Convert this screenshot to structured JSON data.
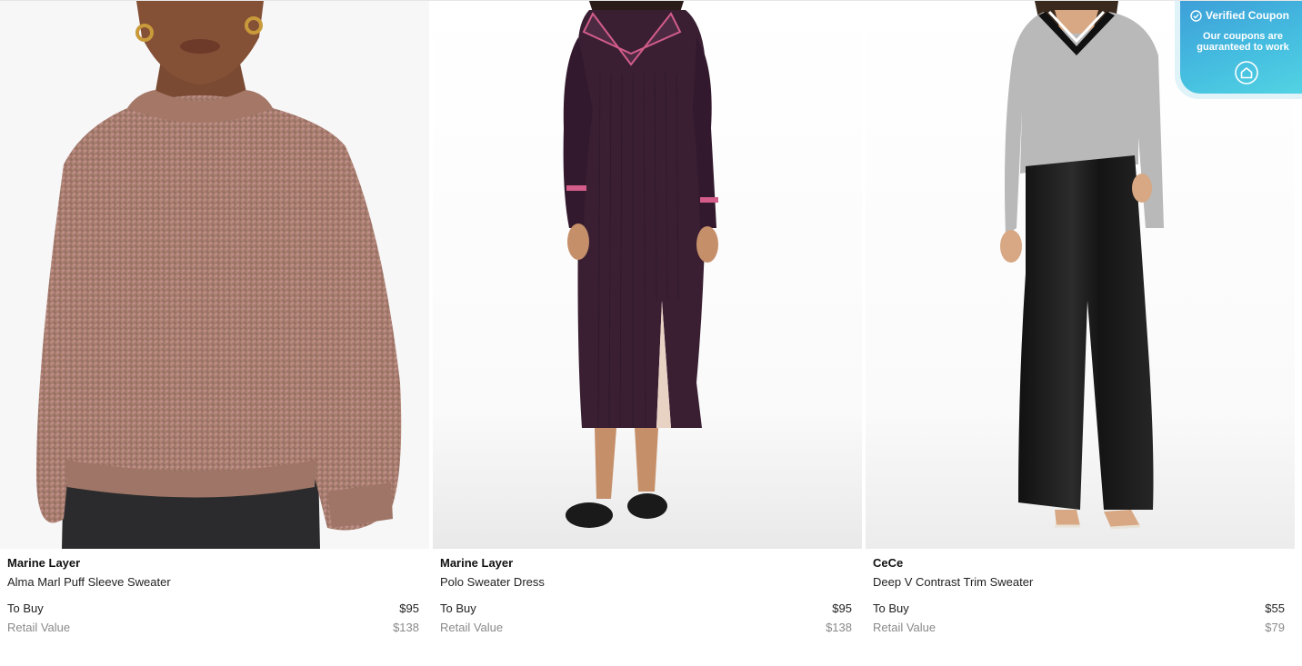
{
  "products": [
    {
      "brand": "Marine Layer",
      "name": "Alma Marl Puff Sleeve Sweater",
      "buy_label": "To Buy",
      "buy_price": "$95",
      "retail_label": "Retail Value",
      "retail_price": "$138"
    },
    {
      "brand": "Marine Layer",
      "name": "Polo Sweater Dress",
      "buy_label": "To Buy",
      "buy_price": "$95",
      "retail_label": "Retail Value",
      "retail_price": "$138"
    },
    {
      "brand": "CeCe",
      "name": "Deep V Contrast Trim Sweater",
      "buy_label": "To Buy",
      "buy_price": "$55",
      "retail_label": "Retail Value",
      "retail_price": "$79"
    }
  ],
  "coupon_badge": {
    "title": "Verified Coupon",
    "subtitle": "Our coupons are guaranteed to work",
    "check_icon": "check-circle-icon",
    "home_icon": "home-icon"
  },
  "colors": {
    "badge_start": "#3d9fd8",
    "badge_end": "#52d3e3",
    "retail_text": "#8a8a8a",
    "sweater_pink": "#b08070",
    "dress_plum": "#3a1f33",
    "grey_sweater": "#b8b8b8",
    "leather_black": "#1a1a1a"
  }
}
